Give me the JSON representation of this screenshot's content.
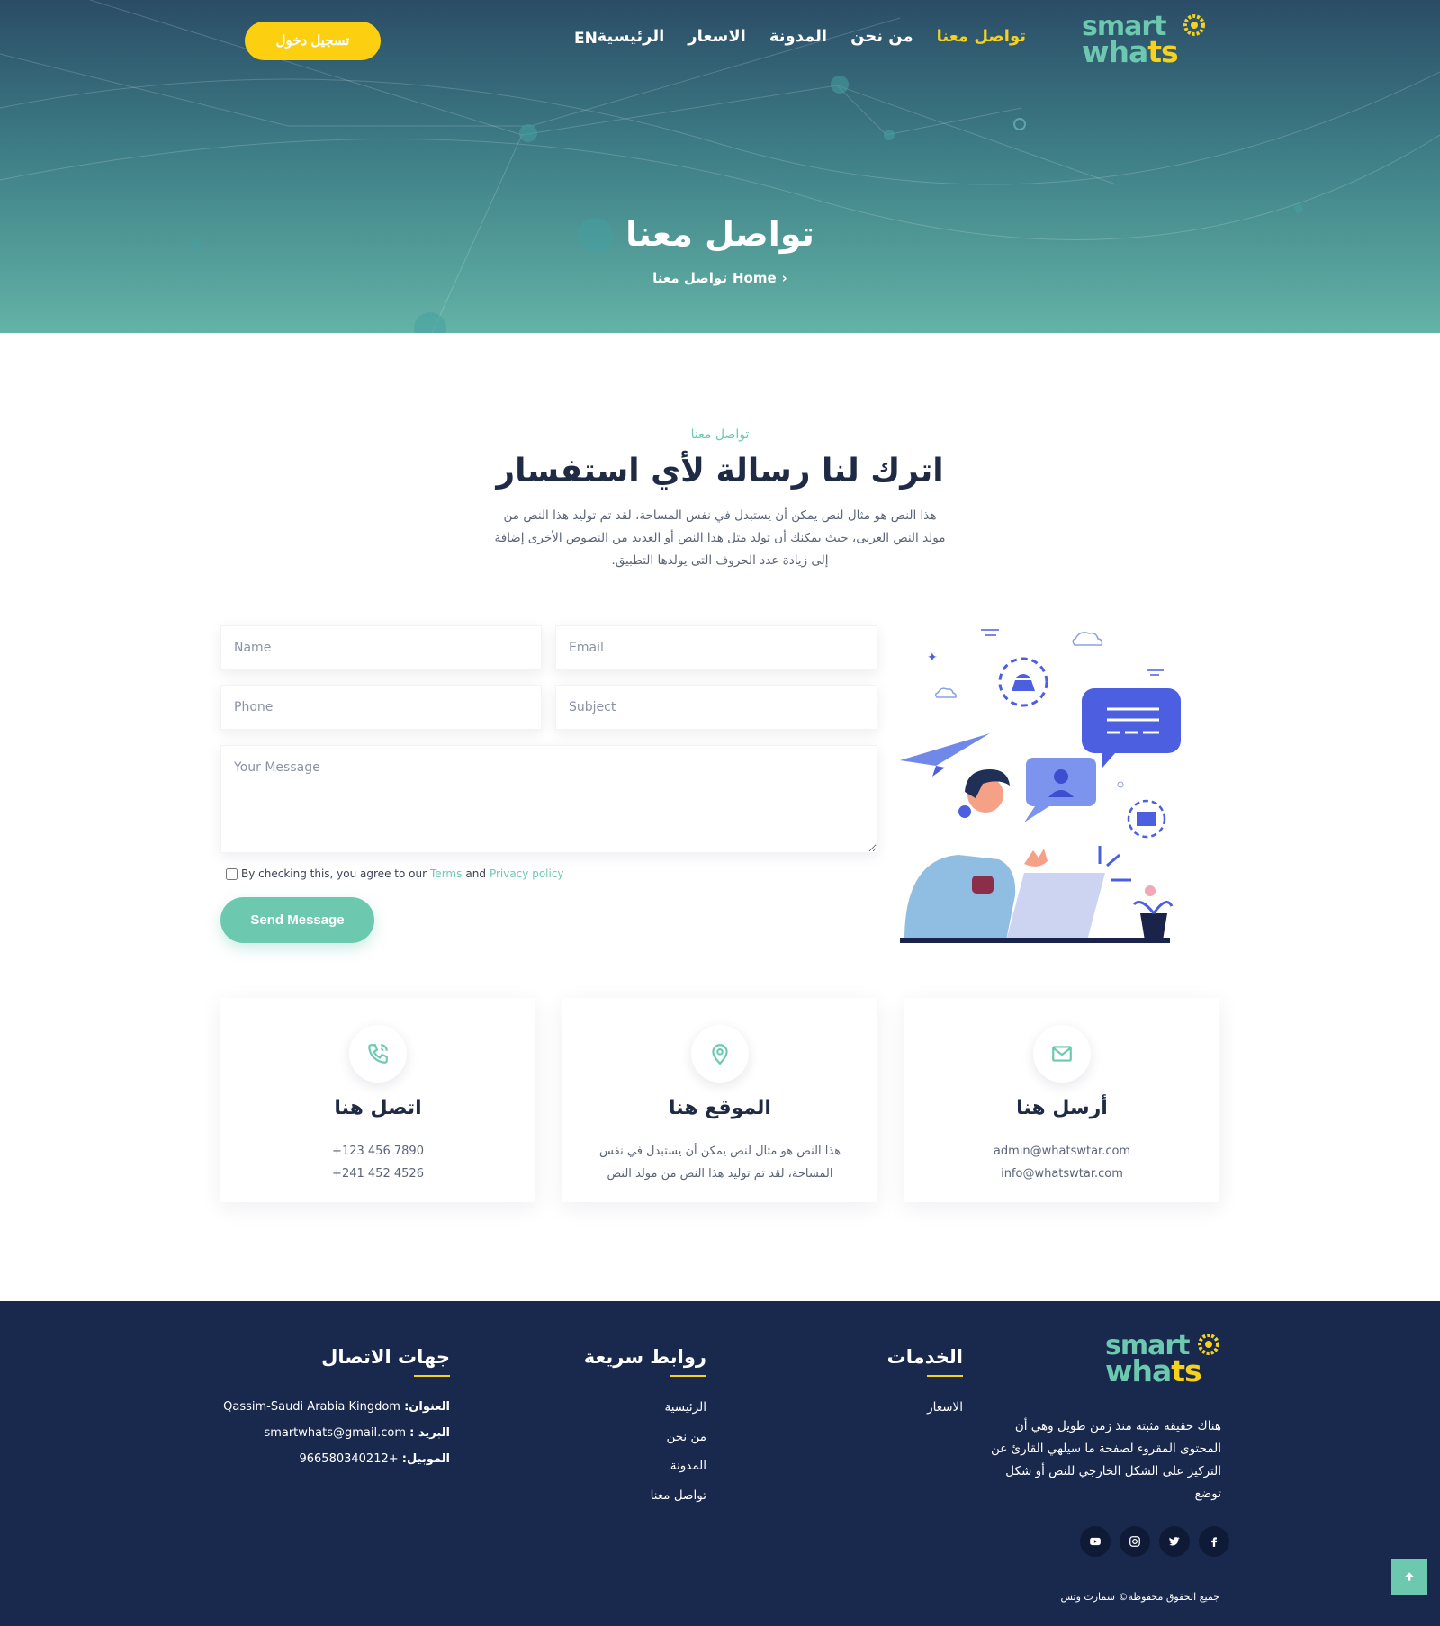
{
  "nav": {
    "brand_line1": "smart",
    "brand_line2_a": "wha",
    "brand_line2_b": "ts",
    "items": [
      {
        "label": "الرئيسية"
      },
      {
        "label": "الاسعار"
      },
      {
        "label": "المدونة"
      },
      {
        "label": "من نحن"
      },
      {
        "label": "تواصل معنا",
        "active": true
      }
    ],
    "lang": "EN",
    "login_label": "تسجيل دخول"
  },
  "hero": {
    "title": "تواصل معنا",
    "breadcrumb_home": "Home",
    "breadcrumb_sep": "›",
    "breadcrumb_current": "تواصل معنا"
  },
  "section": {
    "eyebrow": "تواصل معنا",
    "title": "اترك لنا رسالة لأي استفسار",
    "description": "هذا النص هو مثال لنص يمكن أن يستبدل في نفس المساحة، لقد تم توليد هذا النص من مولد النص العربى، حيث يمكنك أن تولد مثل هذا النص أو العديد من النصوص الأخرى إضافة إلى زيادة عدد الحروف التى يولدها التطبيق."
  },
  "form": {
    "name_placeholder": "Name",
    "email_placeholder": "Email",
    "phone_placeholder": "Phone",
    "subject_placeholder": "Subject",
    "message_placeholder": "Your Message",
    "agree_text": "By checking this, you agree to our",
    "terms_label": "Terms",
    "and_text": "and",
    "privacy_label": "Privacy policy",
    "send_label": "Send Message"
  },
  "cards": [
    {
      "icon": "mail-icon",
      "title": "أرسل هنا",
      "lines": [
        "admin@whatswtar.com",
        "info@whatswtar.com"
      ]
    },
    {
      "icon": "location-pin-icon",
      "title": "الموقع هنا",
      "lines": [
        "هذا النص هو مثال لنص يمكن أن يستبدل في نفس",
        "المساحة، لقد تم توليد هذا النص من مولد النص"
      ]
    },
    {
      "icon": "phone-icon",
      "title": "اتصل هنا",
      "lines": [
        "7890 456 123+",
        "4526 452 241+"
      ]
    }
  ],
  "footer": {
    "about": "هناك حقيقة مثبتة منذ زمن طويل وهي أن المحتوى المقروء لصفحة ما سيلهي القارئ عن التركيز على الشكل الخارجي للنص أو شكل توضع",
    "services_title": "الخدمات",
    "services_links": [
      "الاسعار"
    ],
    "quick_title": "روابط سريعة",
    "quick_links": [
      "الرئيسية",
      "من نحن",
      "المدونة",
      "تواصل معنا"
    ],
    "contact_title": "جهات الاتصال",
    "address_label": "العنوان:",
    "address_value": "Qassim-Saudi Arabia Kingdom",
    "email_label": "البريد :",
    "email_value": "smartwhats@gmail.com",
    "mobile_label": "الموبيل:",
    "mobile_value": "+966580340212",
    "socials": [
      "facebook-icon",
      "twitter-icon",
      "instagram-icon",
      "youtube-icon"
    ],
    "copyright": "جميع الحقوق محفوظة© سمارت وتس"
  },
  "colors": {
    "accent": "#6cc9b0",
    "brand_yellow": "#f6d21e",
    "footer_bg": "#19284d"
  }
}
